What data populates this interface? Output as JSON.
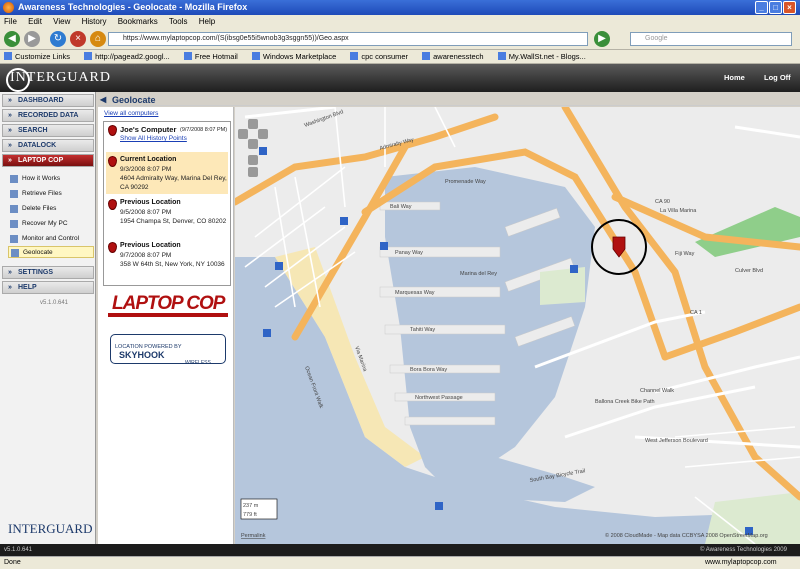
{
  "window": {
    "title": "Awareness Technologies - Geolocate - Mozilla Firefox"
  },
  "menu": [
    "File",
    "Edit",
    "View",
    "History",
    "Bookmarks",
    "Tools",
    "Help"
  ],
  "nav": {
    "url": "https://www.mylaptopcop.com/(S(ibsg0e55i5wnob3g3sggn55))/Geo.aspx",
    "search_placeholder": "Google"
  },
  "bookmarks": [
    "Customize Links",
    "http://pagead2.googl...",
    "Free Hotmail",
    "Windows Marketplace",
    "cpc consumer",
    "awarenesstech",
    "My.WallSt.net - Blogs..."
  ],
  "app": {
    "logo": "INTERGUARD",
    "home": "Home",
    "logoff": "Log Off"
  },
  "sidebar": {
    "sections": [
      "DASHBOARD",
      "RECORDED DATA",
      "SEARCH",
      "DATALOCK",
      "LAPTOP COP",
      "SETTINGS",
      "HELP"
    ],
    "laptopcop_items": [
      "How it Works",
      "Retrieve Files",
      "Delete Files",
      "Recover My PC",
      "Monitor and Control",
      "Geolocate"
    ],
    "version": "v5.1.0.641",
    "bottom_logo": "INTERGUARD"
  },
  "page": {
    "title": "Geolocate",
    "view_all": "View all computers"
  },
  "computer": {
    "name": "Joe's Computer",
    "date": "(9/7/2008 8:07 PM)",
    "history_link": "Show All History Points"
  },
  "locations": [
    {
      "label": "Current Location",
      "date": "9/3/2008 8:07 PM",
      "address": "4604 Admiralty Way, Marina Del Rey, CA 90292"
    },
    {
      "label": "Previous Location",
      "date": "9/5/2008 8:07 PM",
      "address": "1954 Champa St, Denver, CO 80202"
    },
    {
      "label": "Previous Location",
      "date": "9/7/2008 8:07 PM",
      "address": "358 W 64th St, New York, NY 10036"
    }
  ],
  "branding": {
    "laptopcop": "LAPTOP COP",
    "skyhook_prefix": "LOCATION POWERED BY",
    "skyhook": "SKYHOOK",
    "skyhook_sub": "WIRELESS"
  },
  "map": {
    "streets": [
      "Washington Blvd",
      "Admiralty Way",
      "Promenade Way",
      "Bali Way",
      "Panay Way",
      "Mindanao Way",
      "Marquesas Way",
      "Tahiti Way",
      "Bora Bora Way",
      "Northwest Passage",
      "Fiji Way",
      "Via Marina",
      "Pacific Ave",
      "Ocean Front Walk",
      "La Villa Marina",
      "Culver Blvd",
      "Ballona Creek Bike Path",
      "South Bay Bicycle Trail",
      "Glencoe Ave",
      "Mindanao Way",
      "West Jefferson Boulevard",
      "Marina del Rey",
      "Channel Walk"
    ],
    "highways": [
      "CA 90",
      "CA 1"
    ],
    "scale": [
      "237 m",
      "779 ft"
    ],
    "permalink": "Permalink",
    "attribution": "© 2008 CloudMade - Map data CCBYSA 2008 OpenStreetMap.org"
  },
  "footer": {
    "version": "v5.1.0.641",
    "copyright": "© Awareness Technologies 2009"
  },
  "status": {
    "left": "Done",
    "right": "www.mylaptopcop.com"
  },
  "colors": {
    "accent_red": "#b01010",
    "water": "#b5c6dc",
    "road_major": "#f4b45c",
    "highlight": "#fde8b8"
  }
}
